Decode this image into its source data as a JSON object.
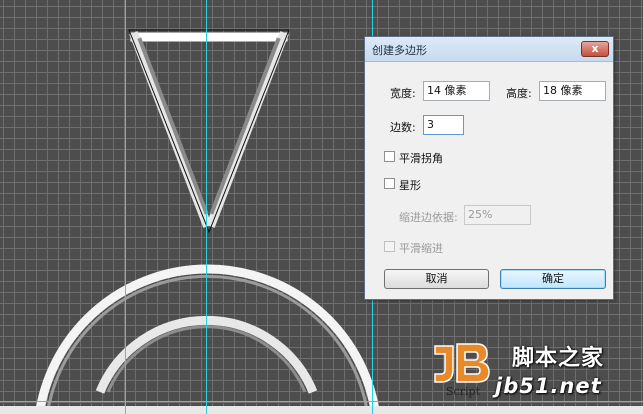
{
  "dialog": {
    "title": "创建多边形",
    "close_glyph": "x",
    "width_label": "宽度:",
    "width_value": "14 像素",
    "height_label": "高度:",
    "height_value": "18 像素",
    "sides_label": "边数:",
    "sides_value": "3",
    "smooth_corners_label": "平滑拐角",
    "star_label": "星形",
    "indent_label": "缩进边依据:",
    "indent_value": "25%",
    "smooth_indents_label": "平滑缩进",
    "cancel_label": "取消",
    "ok_label": "确定"
  },
  "watermark": {
    "script_text": "Script",
    "site_name": "脚本之家",
    "url": "jb51.net"
  },
  "colors": {
    "canvas": "#4d4d4d",
    "grid": "#6e6e6e",
    "guide": "#29d4e2",
    "default_button": "#bee6fd",
    "logo_orange": "#e8892a"
  }
}
